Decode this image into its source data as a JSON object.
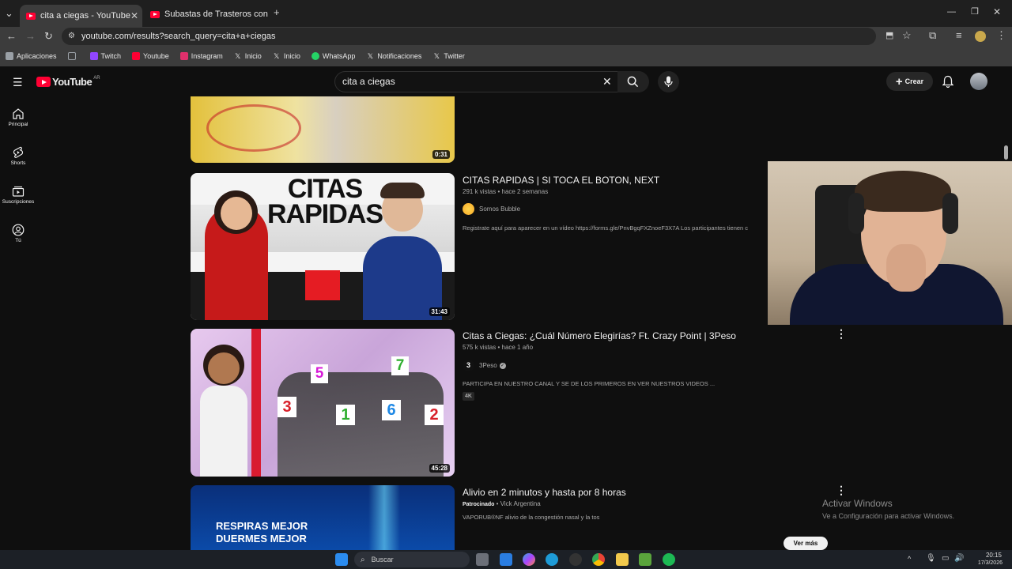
{
  "browser": {
    "tabs": [
      {
        "title": "cita a ciegas - YouTube",
        "active": true
      },
      {
        "title": "Subastas de Trasteros con YouT",
        "active": false
      }
    ],
    "url": "youtube.com/results?search_query=cita+a+ciegas",
    "bookmarks": [
      "Aplicaciones",
      "Twitch",
      "Youtube",
      "Instagram",
      "Inicio",
      "Inicio",
      "WhatsApp",
      "Notificaciones",
      "Twitter"
    ]
  },
  "youtube": {
    "logo": "YouTube",
    "region": "AR",
    "search_query": "cita a ciegas",
    "create_label": "Crear",
    "sidebar": [
      {
        "label": "Principal",
        "icon": "home-icon"
      },
      {
        "label": "Shorts",
        "icon": "shorts-icon"
      },
      {
        "label": "Suscripciones",
        "icon": "subscriptions-icon"
      },
      {
        "label": "Tú",
        "icon": "you-icon"
      }
    ],
    "partial_video": {
      "duration": "0:31"
    },
    "videos": [
      {
        "title": "CITAS RAPIDAS | SI TOCA EL BOTON, NEXT",
        "meta": "291 k vistas • hace 2 semanas",
        "channel": "Somos Bubble",
        "description": "Registrate aquí para aparecer en un vídeo https://forms.gle/PnvBgqFXZnoeF3X7A Los participantes tienen c",
        "duration": "31:43",
        "thumb_text": "CITAS RAPIDAS"
      },
      {
        "title": "Citas a Ciegas: ¿Cuál Número Elegirías? Ft. Crazy Point | 3Peso",
        "meta": "575 k vistas • hace 1 año",
        "channel": "3Peso",
        "description": "PARTICIPA EN NUESTRO CANAL Y SE DE LOS PRIMEROS EN VER NUESTROS VIDEOS ...",
        "badge": "4K",
        "duration": "45:28",
        "thumb_numbers": [
          "5",
          "7",
          "3",
          "1",
          "6",
          "2"
        ]
      }
    ],
    "ad": {
      "title": "Alivio en 2 minutos y hasta por 8 horas",
      "sponsored": "Patrocinado",
      "advertiser": "Vick Argentina",
      "description": "VAPORUB®NF alivio de la congestión nasal y la tos",
      "thumb_line1": "RESPIRAS MEJOR",
      "thumb_line2": "DUERMES MEJOR",
      "more_label": "Ver más"
    }
  },
  "windows": {
    "activate_title": "Activar Windows",
    "activate_sub": "Ve a Configuración para activar Windows.",
    "search_placeholder": "Buscar",
    "time": "20:15",
    "date": "17/3/2026"
  },
  "colors": {
    "yt_red": "#ff0033",
    "bg": "#0f0f0f",
    "chrome": "#3c3c3c"
  }
}
